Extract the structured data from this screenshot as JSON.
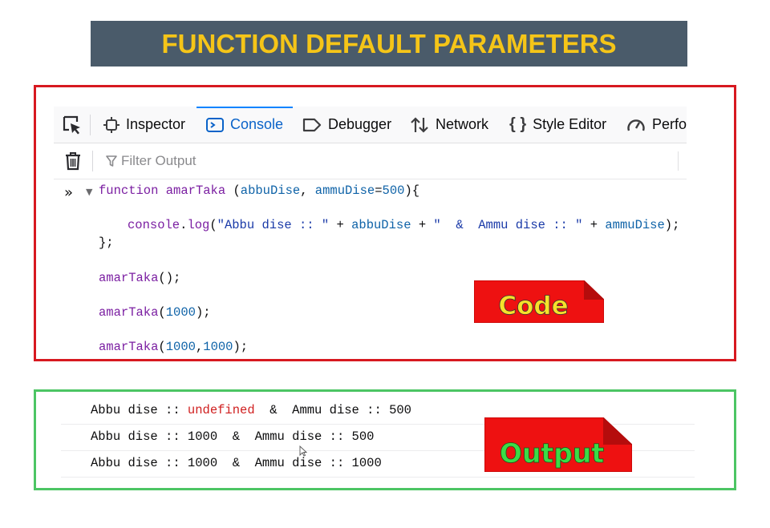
{
  "title": "FUNCTION DEFAULT PARAMETERS",
  "devtools": {
    "tabs": [
      {
        "label": "Inspector",
        "icon": "inspector-icon"
      },
      {
        "label": "Console",
        "icon": "console-icon",
        "active": true
      },
      {
        "label": "Debugger",
        "icon": "debugger-icon"
      },
      {
        "label": "Network",
        "icon": "network-icon"
      },
      {
        "label": "Style Editor",
        "icon": "style-editor-icon"
      },
      {
        "label": "Perfo",
        "icon": "performance-icon"
      }
    ],
    "filter_placeholder": "Filter Output",
    "accent": "#0a84ff"
  },
  "code": {
    "line1": {
      "kw": "function",
      "name": "amarTaka",
      "open": " (",
      "p1": "abbuDise",
      "comma": ", ",
      "p2": "ammuDise",
      "eq": "=",
      "def": "500",
      "close": "){"
    },
    "line2": {
      "obj": "console",
      "dot": ".",
      "method": "log",
      "open": "(",
      "s1": "\"Abbu dise :: \"",
      "plus1": " + ",
      "v1": "abbuDise",
      "plus2": " + ",
      "s2": "\"  &  Ammu dise :: \"",
      "plus3": " + ",
      "v2": "ammuDise",
      "close": ");"
    },
    "line3": "};",
    "call1": {
      "name": "amarTaka",
      "args": "();"
    },
    "call2": {
      "name": "amarTaka",
      "open": "(",
      "a1": "1000",
      "close": ");"
    },
    "call3": {
      "name": "amarTaka",
      "open": "(",
      "a1": "1000",
      "comma": ",",
      "a2": "1000",
      "close": ");"
    }
  },
  "output": {
    "row1": {
      "pre": "Abbu dise :: ",
      "undef": "undefined",
      "post": "  &  Ammu dise :: 500"
    },
    "row2": "Abbu dise :: 1000  &  Ammu dise :: 500",
    "row3": "Abbu dise :: 1000  &  Ammu dise :: 1000"
  },
  "labels": {
    "code": "Code",
    "output": "Output"
  },
  "colors": {
    "title_bg": "#4a5b6a",
    "title_text": "#f5c518",
    "code_border": "#d71920",
    "output_border": "#4cc564",
    "badge_red": "#ee1111",
    "code_label": "#f7e12a",
    "output_label": "#3bdc46"
  }
}
